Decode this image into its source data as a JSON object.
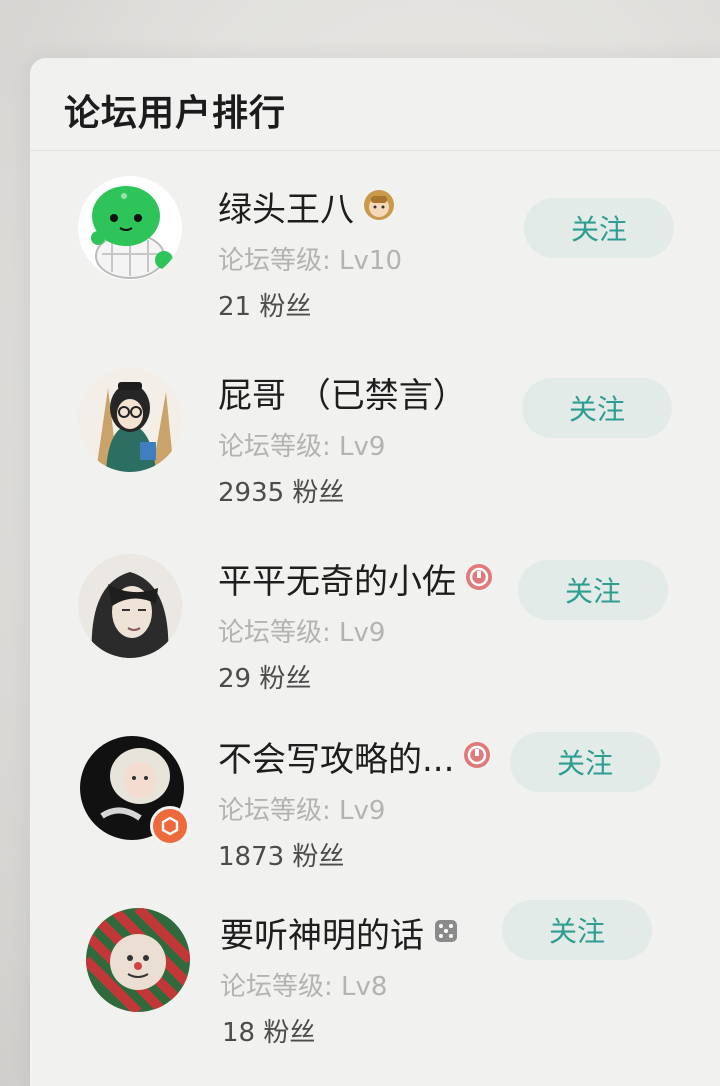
{
  "panel": {
    "title": "论坛用户排行"
  },
  "users": [
    {
      "name": "绿头王八",
      "name_icon": "anime-girl-emoji-icon",
      "level": "论坛等级: Lv10",
      "fans": "21 粉丝",
      "follow_label": "关注"
    },
    {
      "name": "屁哥 （已禁言）",
      "name_icon": "",
      "level": "论坛等级: Lv9",
      "fans": "2935 粉丝",
      "follow_label": "关注"
    },
    {
      "name": "平平无奇的小佐",
      "name_icon": "creator-badge-icon",
      "level": "论坛等级: Lv9",
      "fans": "29 粉丝",
      "follow_label": "关注"
    },
    {
      "name": "不会写攻略的...",
      "name_icon": "creator-badge-icon",
      "level": "论坛等级: Lv9",
      "fans": "1873 粉丝",
      "follow_label": "关注"
    },
    {
      "name": "要听神明的话",
      "name_icon": "dice-icon",
      "level": "论坛等级: Lv8",
      "fans": "18 粉丝",
      "follow_label": "关注"
    }
  ],
  "colors": {
    "accent": "#2f9e90",
    "follow_bg": "#e3ebe8",
    "badge": "#ec6a3c"
  }
}
